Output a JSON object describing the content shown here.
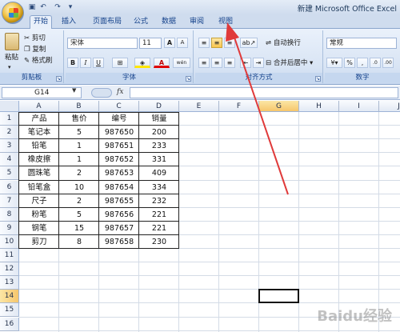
{
  "window": {
    "title": "新建 Microsoft Office Excel"
  },
  "quick_access": [
    "save-icon",
    "undo-icon",
    "redo-icon",
    "customize-icon"
  ],
  "tabs": [
    "开始",
    "插入",
    "页面布局",
    "公式",
    "数据",
    "审阅",
    "视图"
  ],
  "active_tab": "开始",
  "ribbon": {
    "clipboard": {
      "label": "剪贴板",
      "paste": "粘贴",
      "cut": "剪切",
      "copy": "复制",
      "format_painter": "格式刷"
    },
    "font": {
      "label": "字体",
      "font_name": "宋体",
      "font_size": "11",
      "bold": "B",
      "italic": "I",
      "underline": "U",
      "font_color_glyph": "A",
      "grow": "A",
      "shrink": "A",
      "wen": "wén"
    },
    "alignment": {
      "label": "对齐方式",
      "wrap_text": "自动换行",
      "merge_center": "合并后居中"
    },
    "number": {
      "label": "数字",
      "format": "常规",
      "percent": "%",
      "comma": ",",
      "inc_dec": ".0",
      "dec_dec": ".00"
    }
  },
  "formula_bar": {
    "name_box": "G14",
    "fx": "fx",
    "formula": ""
  },
  "columns": [
    "A",
    "B",
    "C",
    "D",
    "E",
    "F",
    "G",
    "H",
    "I",
    "J"
  ],
  "rows": [
    "1",
    "2",
    "3",
    "4",
    "5",
    "6",
    "7",
    "8",
    "9",
    "10",
    "11",
    "12",
    "13",
    "14",
    "15",
    "16"
  ],
  "active_cell": {
    "column": "G",
    "row": "14"
  },
  "table": {
    "headers": [
      "产品",
      "售价",
      "编号",
      "销量"
    ],
    "rows": [
      [
        "笔记本",
        "5",
        "987650",
        "200"
      ],
      [
        "铅笔",
        "1",
        "987651",
        "233"
      ],
      [
        "橡皮擦",
        "1",
        "987652",
        "331"
      ],
      [
        "圆珠笔",
        "2",
        "987653",
        "409"
      ],
      [
        "铅笔盒",
        "10",
        "987654",
        "334"
      ],
      [
        "尺子",
        "2",
        "987655",
        "232"
      ],
      [
        "粉笔",
        "5",
        "987656",
        "221"
      ],
      [
        "钢笔",
        "15",
        "987657",
        "221"
      ],
      [
        "剪刀",
        "8",
        "987658",
        "230"
      ]
    ]
  },
  "watermark": "Baidu经验",
  "colors": {
    "accent": "#15428b",
    "arrow": "#e03a3a",
    "ribbon": "#dbe6f5"
  }
}
